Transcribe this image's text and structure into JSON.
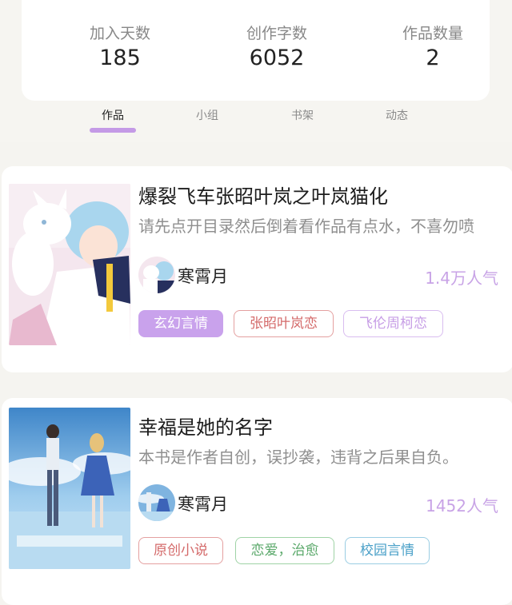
{
  "stats": [
    {
      "label": "加入天数",
      "value": "185"
    },
    {
      "label": "创作字数",
      "value": "6052"
    },
    {
      "label": "作品数量",
      "value": "2"
    }
  ],
  "tabs": [
    {
      "label": "作品",
      "active": true
    },
    {
      "label": "小组",
      "active": false
    },
    {
      "label": "书架",
      "active": false
    },
    {
      "label": "动态",
      "active": false
    }
  ],
  "books": [
    {
      "title": "爆裂飞车张昭叶岚之叶岚猫化",
      "description": "请先点开目录然后倒着看作品有点水，不喜勿喷",
      "author": "寒霄月",
      "popularity": "1.4万人气",
      "tags": [
        {
          "label": "玄幻言情",
          "color": "#ffffff",
          "bg": "#c9a2ec",
          "border": "#c9a2ec"
        },
        {
          "label": "张昭叶岚恋",
          "color": "#d46a6a",
          "bg": "#ffffff",
          "border": "#e4a0a0"
        },
        {
          "label": "飞伦周柯恋",
          "color": "#c79ee6",
          "bg": "#ffffff",
          "border": "#d9bdf0"
        }
      ]
    },
    {
      "title": "幸福是她的名字",
      "description": "本书是作者自创，误抄袭，违背之后果自负。",
      "author": "寒霄月",
      "popularity": "1452人气",
      "tags": [
        {
          "label": "原创小说",
          "color": "#d46a6a",
          "bg": "#ffffff",
          "border": "#e4a0a0"
        },
        {
          "label": "恋爱，治愈",
          "color": "#5aa86a",
          "bg": "#ffffff",
          "border": "#9fd3a6"
        },
        {
          "label": "校园言情",
          "color": "#4aa0c8",
          "bg": "#ffffff",
          "border": "#9acde3"
        }
      ]
    }
  ]
}
